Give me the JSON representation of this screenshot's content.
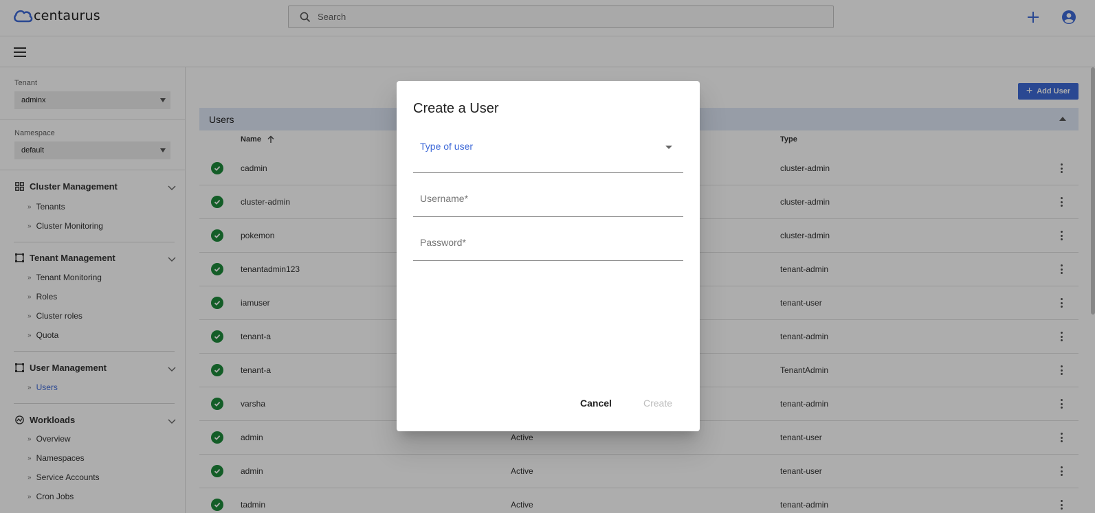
{
  "app": {
    "brand": "centaurus",
    "search_placeholder": "Search",
    "accent_color": "#3f6ad8"
  },
  "sidebar": {
    "tenant": {
      "label": "Tenant",
      "value": "adminx"
    },
    "namespace": {
      "label": "Namespace",
      "value": "default"
    },
    "sections": [
      {
        "title": "Cluster Management",
        "icon": "grid-icon",
        "items": [
          "Tenants",
          "Cluster Monitoring"
        ]
      },
      {
        "title": "Tenant Management",
        "icon": "frame-icon",
        "items": [
          "Tenant Monitoring",
          "Roles",
          "Cluster roles",
          "Quota"
        ]
      },
      {
        "title": "User Management",
        "icon": "frame-icon",
        "items": [
          "Users"
        ]
      },
      {
        "title": "Workloads",
        "icon": "workloads-icon",
        "items": [
          "Overview",
          "Namespaces",
          "Service Accounts",
          "Cron Jobs"
        ]
      }
    ],
    "active_item": "Users"
  },
  "main": {
    "add_user_label": "Add User",
    "panel_title": "Users",
    "columns": {
      "name": "Name",
      "type": "Type"
    },
    "rows": [
      {
        "name": "cadmin",
        "status": "",
        "type": "cluster-admin"
      },
      {
        "name": "cluster-admin",
        "status": "",
        "type": "cluster-admin"
      },
      {
        "name": "pokemon",
        "status": "",
        "type": "cluster-admin"
      },
      {
        "name": "tenantadmin123",
        "status": "",
        "type": "tenant-admin"
      },
      {
        "name": "iamuser",
        "status": "",
        "type": "tenant-user"
      },
      {
        "name": "tenant-a",
        "status": "",
        "type": "tenant-admin"
      },
      {
        "name": "tenant-a",
        "status": "",
        "type": "TenantAdmin"
      },
      {
        "name": "varsha",
        "status": "",
        "type": "tenant-admin"
      },
      {
        "name": "admin",
        "status": "Active",
        "type": "tenant-user"
      },
      {
        "name": "admin",
        "status": "Active",
        "type": "tenant-user"
      },
      {
        "name": "tadmin",
        "status": "Active",
        "type": "tenant-admin"
      }
    ]
  },
  "dialog": {
    "title": "Create a User",
    "type_label": "Type of user",
    "username_label": "Username*",
    "password_label": "Password*",
    "cancel_label": "Cancel",
    "create_label": "Create"
  }
}
